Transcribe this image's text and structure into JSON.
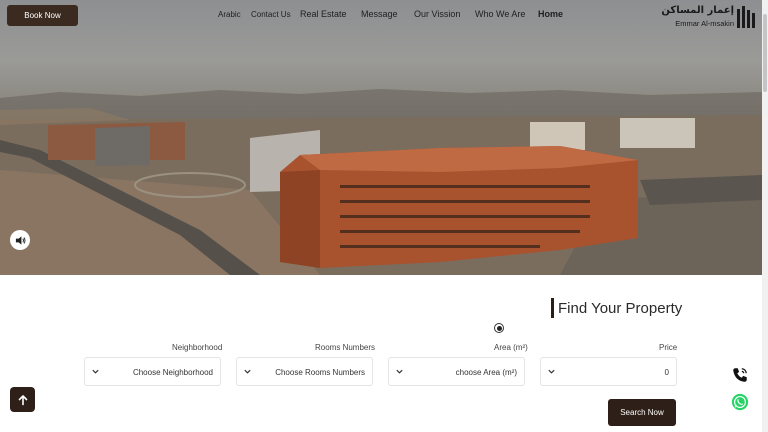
{
  "header": {
    "book_label": "Book Now",
    "nav": {
      "arabic": "Arabic",
      "contact": "Contact Us",
      "real_estate": "Real Estate",
      "message": "Message",
      "vision": "Our Vission",
      "who": "Who We Are",
      "home": "Home"
    },
    "logo_ar": "إعمار المساكن",
    "logo_en": "Emmar Al-msakin"
  },
  "hero": {
    "sound_icon": "speaker-icon"
  },
  "search": {
    "title": "Find Your Property",
    "fields": {
      "neighborhood": {
        "label": "Neighborhood",
        "value": "Choose Neighborhood"
      },
      "rooms": {
        "label": "Rooms Numbers",
        "value": "Choose Rooms Numbers"
      },
      "area": {
        "label": "Area (m²)",
        "value": "choose Area (m²)"
      },
      "price": {
        "label": "Price",
        "value": "0"
      }
    },
    "submit_label": "Search Now"
  },
  "floating": {
    "top_icon": "arrow-up-icon",
    "phone_icon": "phone-icon",
    "whatsapp_icon": "whatsapp-icon"
  },
  "colors": {
    "brand_dark": "#2e2018",
    "whatsapp": "#25d366"
  }
}
